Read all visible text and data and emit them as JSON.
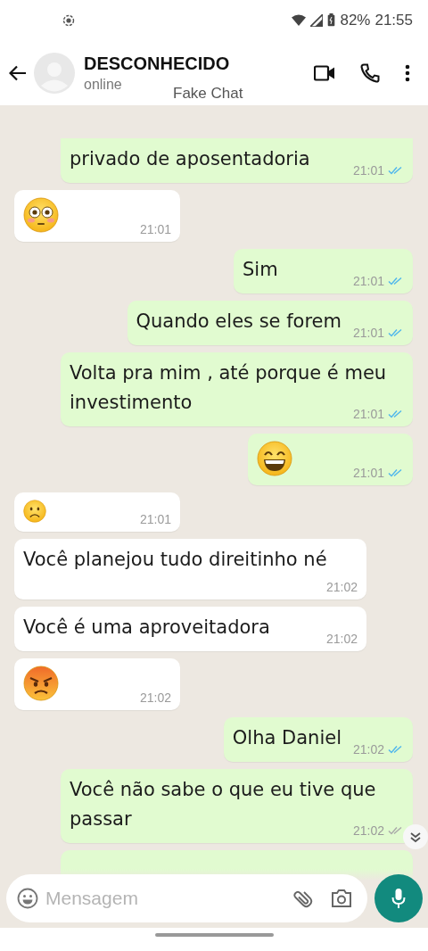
{
  "status_bar": {
    "battery": "82%",
    "time": "21:55"
  },
  "header": {
    "name": "DESCONHECIDO",
    "status": "online",
    "overlay_label": "Fake Chat"
  },
  "messages": [
    {
      "kind": "text",
      "outgoing": true,
      "text": "privado de aposentadoria",
      "time": "21:01",
      "read": true,
      "cut_top": true
    },
    {
      "kind": "flushed",
      "outgoing": false,
      "time": "21:01"
    },
    {
      "kind": "text",
      "outgoing": true,
      "text": "Sim",
      "time": "21:01",
      "read": true
    },
    {
      "kind": "text",
      "outgoing": true,
      "text": "Quando eles se forem",
      "time": "21:01",
      "read": true
    },
    {
      "kind": "text",
      "outgoing": true,
      "text": "Volta pra mim , até porque é meu investimento",
      "time": "21:01",
      "read": true
    },
    {
      "kind": "grin",
      "outgoing": true,
      "time": "21:01",
      "read": true
    },
    {
      "kind": "frown",
      "outgoing": false,
      "time": "21:01"
    },
    {
      "kind": "text",
      "outgoing": false,
      "text": "Você planejou tudo direitinho né",
      "time": "21:02"
    },
    {
      "kind": "text",
      "outgoing": false,
      "text": "Você é uma aproveitadora",
      "time": "21:02"
    },
    {
      "kind": "angry",
      "outgoing": false,
      "time": "21:02"
    },
    {
      "kind": "text",
      "outgoing": true,
      "text": "Olha Daniel",
      "time": "21:02",
      "read": true
    },
    {
      "kind": "text",
      "outgoing": true,
      "text": "Você não sabe o que eu tive que passar",
      "time": "21:02",
      "read": false
    }
  ],
  "composer": {
    "placeholder": "Mensagem"
  }
}
